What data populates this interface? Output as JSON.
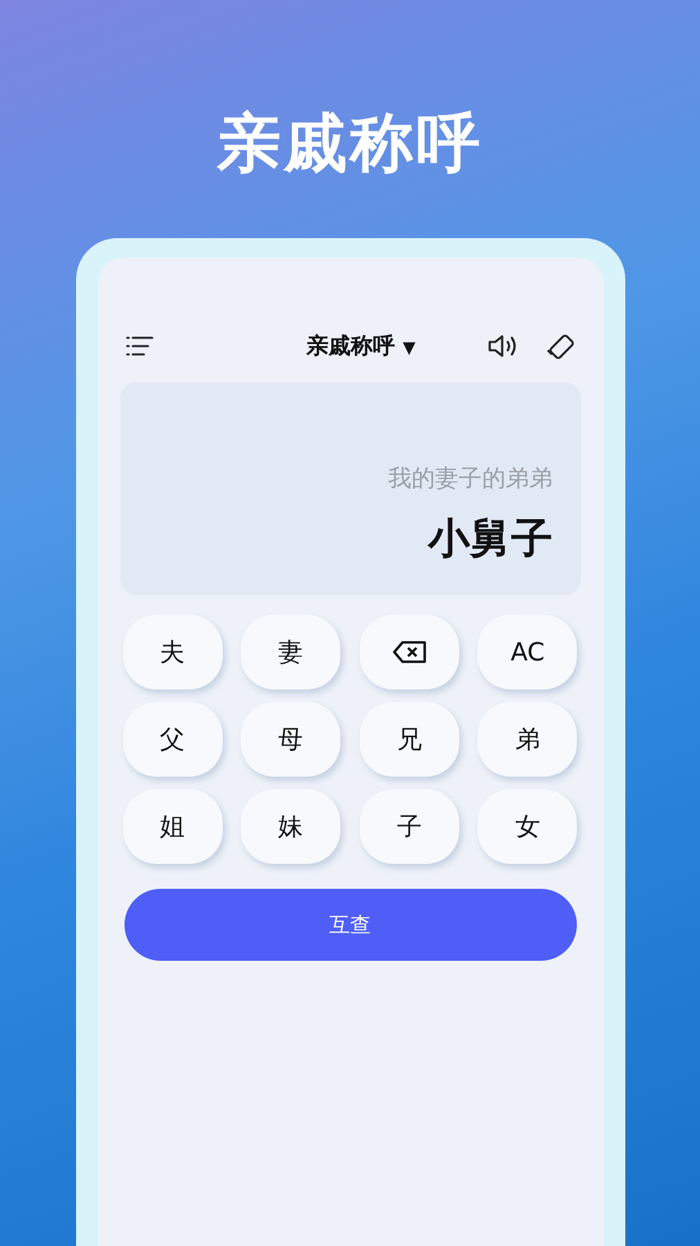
{
  "headline": "亲戚称呼",
  "toolbar": {
    "title": "亲戚称呼",
    "dropdown_glyph": "▼"
  },
  "display": {
    "expression": "我的妻子的弟弟",
    "result": "小舅子"
  },
  "keys": [
    {
      "kind": "text",
      "label": "夫"
    },
    {
      "kind": "text",
      "label": "妻"
    },
    {
      "kind": "backspace"
    },
    {
      "kind": "text",
      "label": "AC"
    },
    {
      "kind": "text",
      "label": "父"
    },
    {
      "kind": "text",
      "label": "母"
    },
    {
      "kind": "text",
      "label": "兄"
    },
    {
      "kind": "text",
      "label": "弟"
    },
    {
      "kind": "text",
      "label": "姐"
    },
    {
      "kind": "text",
      "label": "妹"
    },
    {
      "kind": "text",
      "label": "子"
    },
    {
      "kind": "text",
      "label": "女"
    }
  ],
  "action_button": "互查"
}
